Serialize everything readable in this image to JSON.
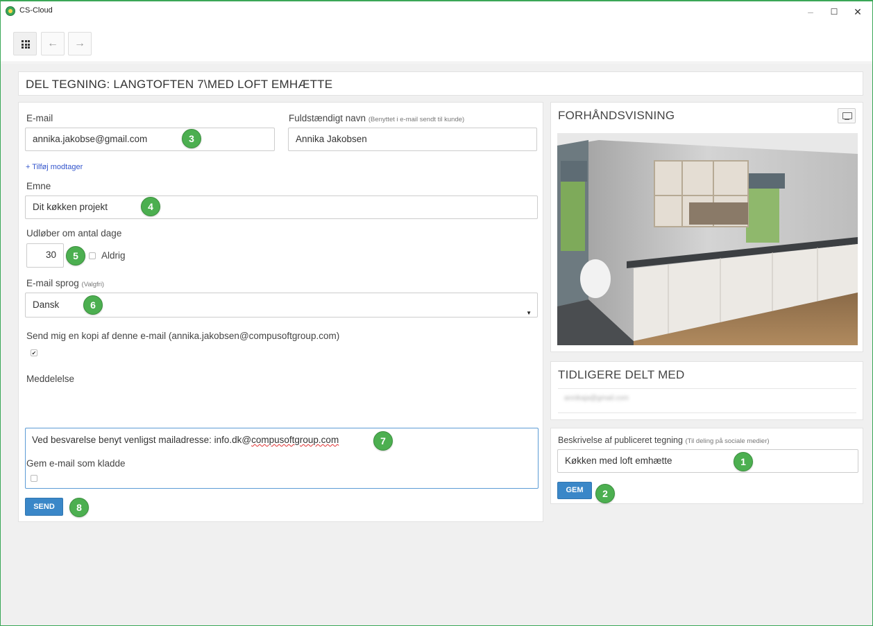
{
  "window": {
    "title": "CS-Cloud",
    "minimize": "–",
    "maximize": "☐",
    "close": "✕"
  },
  "toolbar": {
    "back": "←",
    "forward": "→"
  },
  "page": {
    "title": "DEL TEGNING: LANGTOFTEN 7\\MED LOFT EMHÆTTE"
  },
  "form": {
    "email_label": "E-mail",
    "email_value": "annika.jakobse@gmail.com",
    "fullname_label": "Fuldstændigt navn",
    "fullname_hint": "(Benyttet i e-mail sendt til kunde)",
    "fullname_value": "Annika Jakobsen",
    "add_recipient": "+ Tilføj modtager",
    "subject_label": "Emne",
    "subject_value": "Dit køkken projekt",
    "expires_label": "Udløber om antal dage",
    "expires_value": "30",
    "never_label": "Aldrig",
    "language_label": "E-mail sprog",
    "language_hint": "(Valgfri)",
    "language_value": "Dansk",
    "copy_label": "Send mig en kopi af denne e-mail (annika.jakobsen@compusoftgroup.com)",
    "copy_checked": "✔",
    "message_label": "Meddelelse",
    "message_prefix": "Ved besvarelse benyt venligst mailadresse: info.dk@",
    "message_underlined": "compusoftgroup.com",
    "draft_label": "Gem e-mail som kladde",
    "send_button": "SEND"
  },
  "preview": {
    "heading": "FORHÅNDSVISNING"
  },
  "shared": {
    "heading": "TIDLIGERE DELT MED",
    "blurred_email": "annikaja@gmail.com"
  },
  "publish": {
    "label": "Beskrivelse af publiceret tegning",
    "hint": "(Til deling på sociale medier)",
    "value": "Køkken med loft emhætte",
    "save_button": "GEM"
  },
  "badges": {
    "b1": "1",
    "b2": "2",
    "b3": "3",
    "b4": "4",
    "b5": "5",
    "b6": "6",
    "b7": "7",
    "b8": "8"
  },
  "colors": {
    "accent_green": "#4caf50",
    "button_blue": "#3a87c8",
    "window_border": "#3aa757"
  }
}
